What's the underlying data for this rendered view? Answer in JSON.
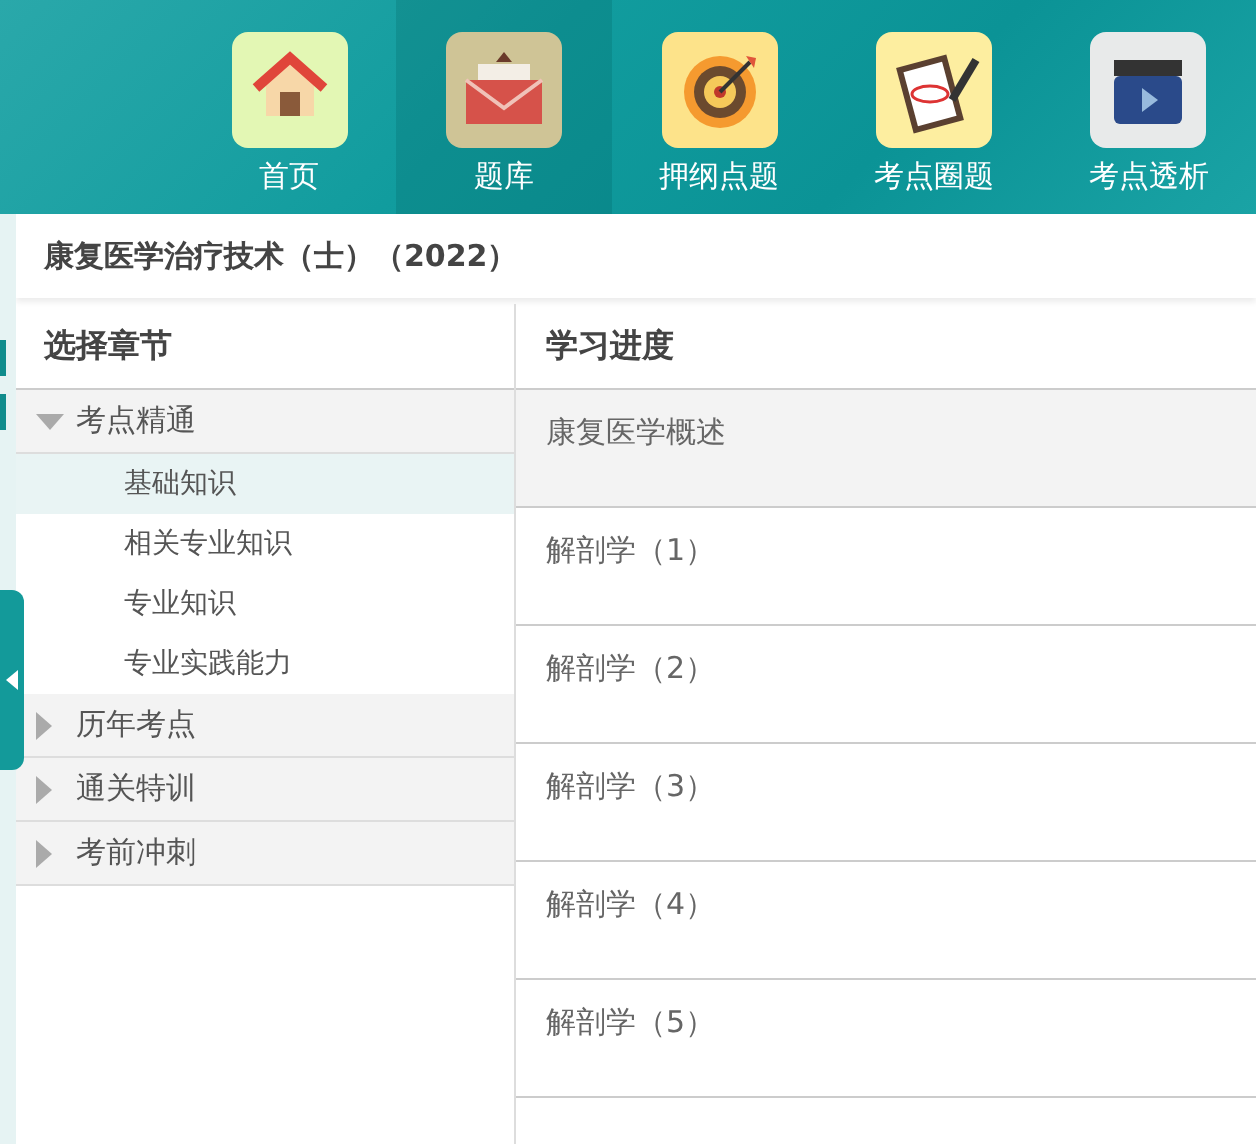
{
  "nav": [
    {
      "label": "首页",
      "selected": false
    },
    {
      "label": "题库",
      "selected": true
    },
    {
      "label": "押纲点题",
      "selected": false
    },
    {
      "label": "考点圈题",
      "selected": false
    },
    {
      "label": "考点透析",
      "selected": false
    }
  ],
  "course_title": "康复医学治疗技术（士）（2022）",
  "chapters": {
    "heading": "选择章节",
    "groups": [
      {
        "label": "考点精通",
        "expanded": true,
        "children": [
          {
            "label": "基础知识",
            "selected": true
          },
          {
            "label": "相关专业知识",
            "selected": false
          },
          {
            "label": "专业知识",
            "selected": false
          },
          {
            "label": "专业实践能力",
            "selected": false
          }
        ]
      },
      {
        "label": "历年考点",
        "expanded": false
      },
      {
        "label": "通关特训",
        "expanded": false
      },
      {
        "label": "考前冲刺",
        "expanded": false
      }
    ]
  },
  "progress": {
    "heading": "学习进度",
    "rows": [
      {
        "label": "康复医学概述",
        "selected": true
      },
      {
        "label": "解剖学（1）",
        "selected": false
      },
      {
        "label": "解剖学（2）",
        "selected": false
      },
      {
        "label": "解剖学（3）",
        "selected": false
      },
      {
        "label": "解剖学（4）",
        "selected": false
      },
      {
        "label": "解剖学（5）",
        "selected": false
      }
    ]
  }
}
